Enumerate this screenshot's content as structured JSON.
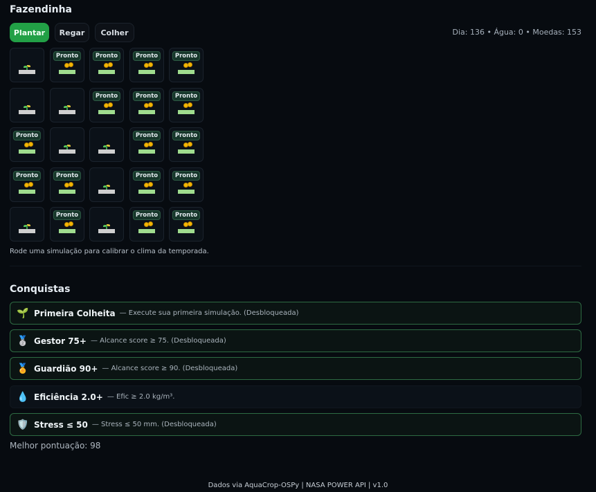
{
  "app_title": "Fazendinha",
  "actions": {
    "plant_label": "Plantar",
    "water_label": "Regar",
    "harvest_label": "Colher"
  },
  "stats_text": "Dia: 136 • Água: 0 • Moedas: 153",
  "grid": {
    "ready_label": "Pronto",
    "cells": [
      [
        "sprout",
        "ready",
        "ready",
        "ready",
        "ready"
      ],
      [
        "sprout",
        "sprout",
        "ready",
        "ready",
        "ready"
      ],
      [
        "ready",
        "sprout",
        "sprout",
        "ready",
        "ready"
      ],
      [
        "ready",
        "ready",
        "sprout",
        "ready",
        "ready"
      ],
      [
        "sprout",
        "ready",
        "sprout",
        "ready",
        "ready"
      ]
    ]
  },
  "hint": "Rode uma simulação para calibrar o clima da temporada.",
  "achievements": {
    "title": "Conquistas",
    "items": [
      {
        "icon": "seedling-icon",
        "emoji": "🌱",
        "name": "Primeira Colheita",
        "desc": "— Execute sua primeira simulação. (Desbloqueada)",
        "unlocked": true
      },
      {
        "icon": "silver-medal-icon",
        "emoji": "🥈",
        "name": "Gestor 75+",
        "desc": "— Alcance score ≥ 75. (Desbloqueada)",
        "unlocked": true
      },
      {
        "icon": "gold-medal-icon",
        "emoji": "🏅",
        "name": "Guardião 90+",
        "desc": "— Alcance score ≥ 90. (Desbloqueada)",
        "unlocked": true
      },
      {
        "icon": "droplet-icon",
        "emoji": "💧",
        "name": "Eficiência 2.0+",
        "desc": "— Efic ≥ 2.0 kg/m³.",
        "unlocked": false
      },
      {
        "icon": "shield-icon",
        "emoji": "🛡️",
        "name": "Stress ≤ 50",
        "desc": "— Stress ≤ 50 mm. (Desbloqueada)",
        "unlocked": true
      }
    ]
  },
  "best_score": "Melhor pontuação: 98",
  "footer": "Dados via AquaCrop-OSPy | NASA POWER API | v1.0",
  "colors": {
    "accent": "#22a046",
    "ready_soil": "#9fdc8e",
    "coin": "#f2b705"
  }
}
